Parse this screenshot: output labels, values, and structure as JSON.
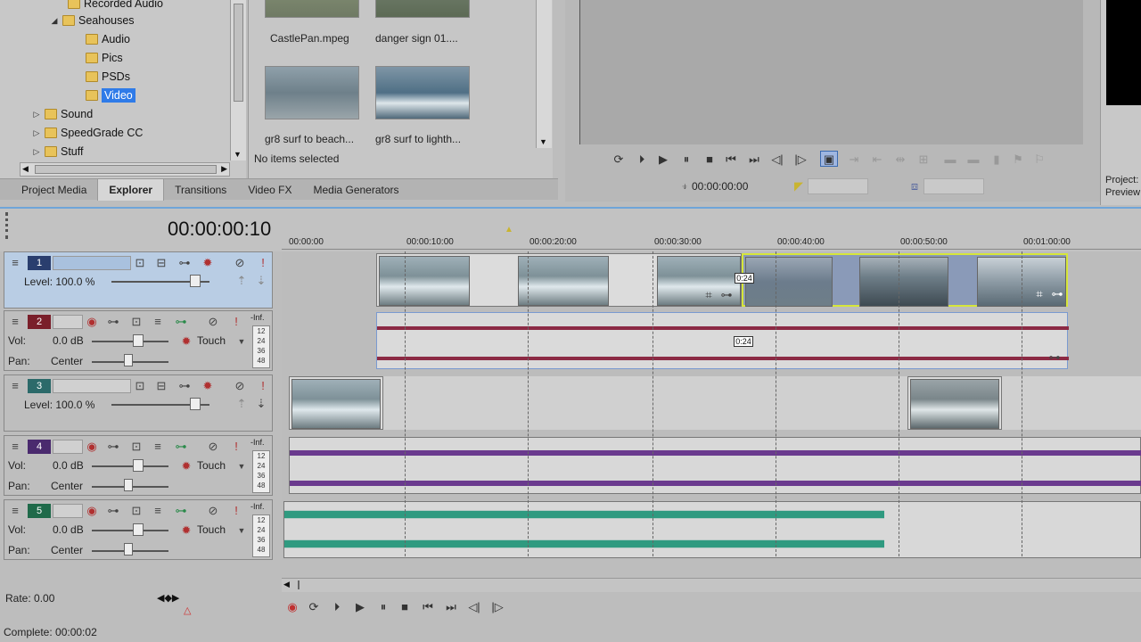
{
  "explorer": {
    "tree": [
      {
        "label": "Recorded Audio",
        "level": 2,
        "expanded": false,
        "selected": false
      },
      {
        "label": "Seahouses",
        "level": 1,
        "expanded": true,
        "selected": false
      },
      {
        "label": "Audio",
        "level": 2,
        "expanded": false,
        "selected": false
      },
      {
        "label": "Pics",
        "level": 2,
        "expanded": false,
        "selected": false
      },
      {
        "label": "PSDs",
        "level": 2,
        "expanded": false,
        "selected": false
      },
      {
        "label": "Video",
        "level": 2,
        "expanded": false,
        "selected": true
      },
      {
        "label": "Sound",
        "level": 1,
        "expanded": false,
        "selected": false
      },
      {
        "label": "SpeedGrade CC",
        "level": 1,
        "expanded": false,
        "selected": false
      },
      {
        "label": "Stuff",
        "level": 1,
        "expanded": false,
        "selected": false
      }
    ],
    "thumbnails": [
      {
        "label": "CastlePan.mpeg"
      },
      {
        "label": "danger sign 01...."
      },
      {
        "label": "gr8 surf to beach..."
      },
      {
        "label": "gr8 surf to lighth..."
      }
    ],
    "status": "No items selected"
  },
  "window_tabs": [
    "Project Media",
    "Explorer",
    "Transitions",
    "Video FX",
    "Media Generators"
  ],
  "active_tab": "Explorer",
  "trimmer": {
    "timecode": "00:00:00:00"
  },
  "preview_side": {
    "line1": "Project:",
    "line2": "Preview"
  },
  "timeline": {
    "timecode": "00:00:00:10",
    "ruler": [
      "00:00:00",
      "00:00:10:00",
      "00:00:20:00",
      "00:00:30:00",
      "00:00:40:00",
      "00:00:50:00",
      "00:01:00:00"
    ],
    "crossfade_label": "0:24",
    "tracks": [
      {
        "num": "1",
        "type": "video",
        "level_label": "Level:",
        "level_value": "100.0 %",
        "color": "#2a3e6e",
        "selected": true
      },
      {
        "num": "2",
        "type": "audio",
        "vol_label": "Vol:",
        "vol_value": "0.0 dB",
        "pan_label": "Pan:",
        "pan_value": "Center",
        "mode": "Touch",
        "meter_top": "-Inf.",
        "meter_ticks": [
          "12",
          "24",
          "36",
          "48"
        ],
        "color": "#7a1f2a"
      },
      {
        "num": "3",
        "type": "video",
        "level_label": "Level:",
        "level_value": "100.0 %",
        "color": "#2c6a6a",
        "selected": false
      },
      {
        "num": "4",
        "type": "audio",
        "vol_label": "Vol:",
        "vol_value": "0.0 dB",
        "pan_label": "Pan:",
        "pan_value": "Center",
        "mode": "Touch",
        "meter_top": "-Inf.",
        "meter_ticks": [
          "12",
          "24",
          "36",
          "48"
        ],
        "color": "#4a2a6e"
      },
      {
        "num": "5",
        "type": "audio",
        "vol_label": "Vol:",
        "vol_value": "0.0 dB",
        "pan_label": "Pan:",
        "pan_value": "Center",
        "mode": "Touch",
        "meter_top": "-Inf.",
        "meter_ticks": [
          "12",
          "24",
          "36",
          "48"
        ],
        "color": "#1f6a4a"
      }
    ]
  },
  "footer": {
    "rate": "Rate: 0.00",
    "complete": "Complete: 00:00:02"
  },
  "colors": {
    "accent": "#2f7be8",
    "audio_red": "#8c2a44",
    "audio_purple": "#6a3a8e",
    "audio_teal": "#2f9a80",
    "selection": "#d6e63a"
  }
}
